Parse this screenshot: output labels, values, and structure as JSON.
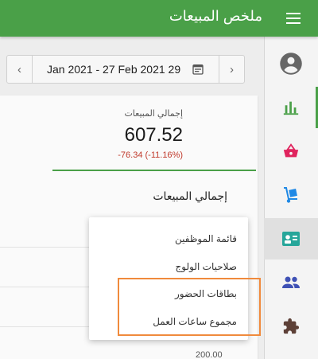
{
  "header": {
    "title": "ملخص المبيعات",
    "menu_icon": "hamburger-menu-icon",
    "brand_color": "#4aa048"
  },
  "date_range": {
    "label": "Jan 2021 - 27 Feb 2021 29",
    "prev_icon": "chevron-left-icon",
    "next_icon": "chevron-right-icon",
    "calendar_icon": "calendar-icon"
  },
  "summary": {
    "title": "إجمالي المبيعات",
    "value": "607.52",
    "change": "-76.34 (-11.16%)",
    "change_color": "#c0392b"
  },
  "section": {
    "title": "إجمالي المبيعات",
    "axis_value": "200.00"
  },
  "dropdown": {
    "items": [
      {
        "label": "قائمة الموظفين"
      },
      {
        "label": "صلاحيات الولوج"
      },
      {
        "label": "بطاقات الحضور"
      },
      {
        "label": "مجموع ساعات العمل"
      }
    ]
  },
  "sidebar": {
    "items": [
      {
        "icon": "account-circle-icon",
        "color": "#666666"
      },
      {
        "icon": "bar-chart-icon",
        "color": "#4aa048"
      },
      {
        "icon": "basket-icon",
        "color": "#e0245e"
      },
      {
        "icon": "hand-truck-icon",
        "color": "#1e88e5"
      },
      {
        "icon": "id-card-icon",
        "color": "#26a69a"
      },
      {
        "icon": "people-icon",
        "color": "#3f51b5"
      },
      {
        "icon": "puzzle-icon",
        "color": "#5d4037"
      }
    ]
  }
}
